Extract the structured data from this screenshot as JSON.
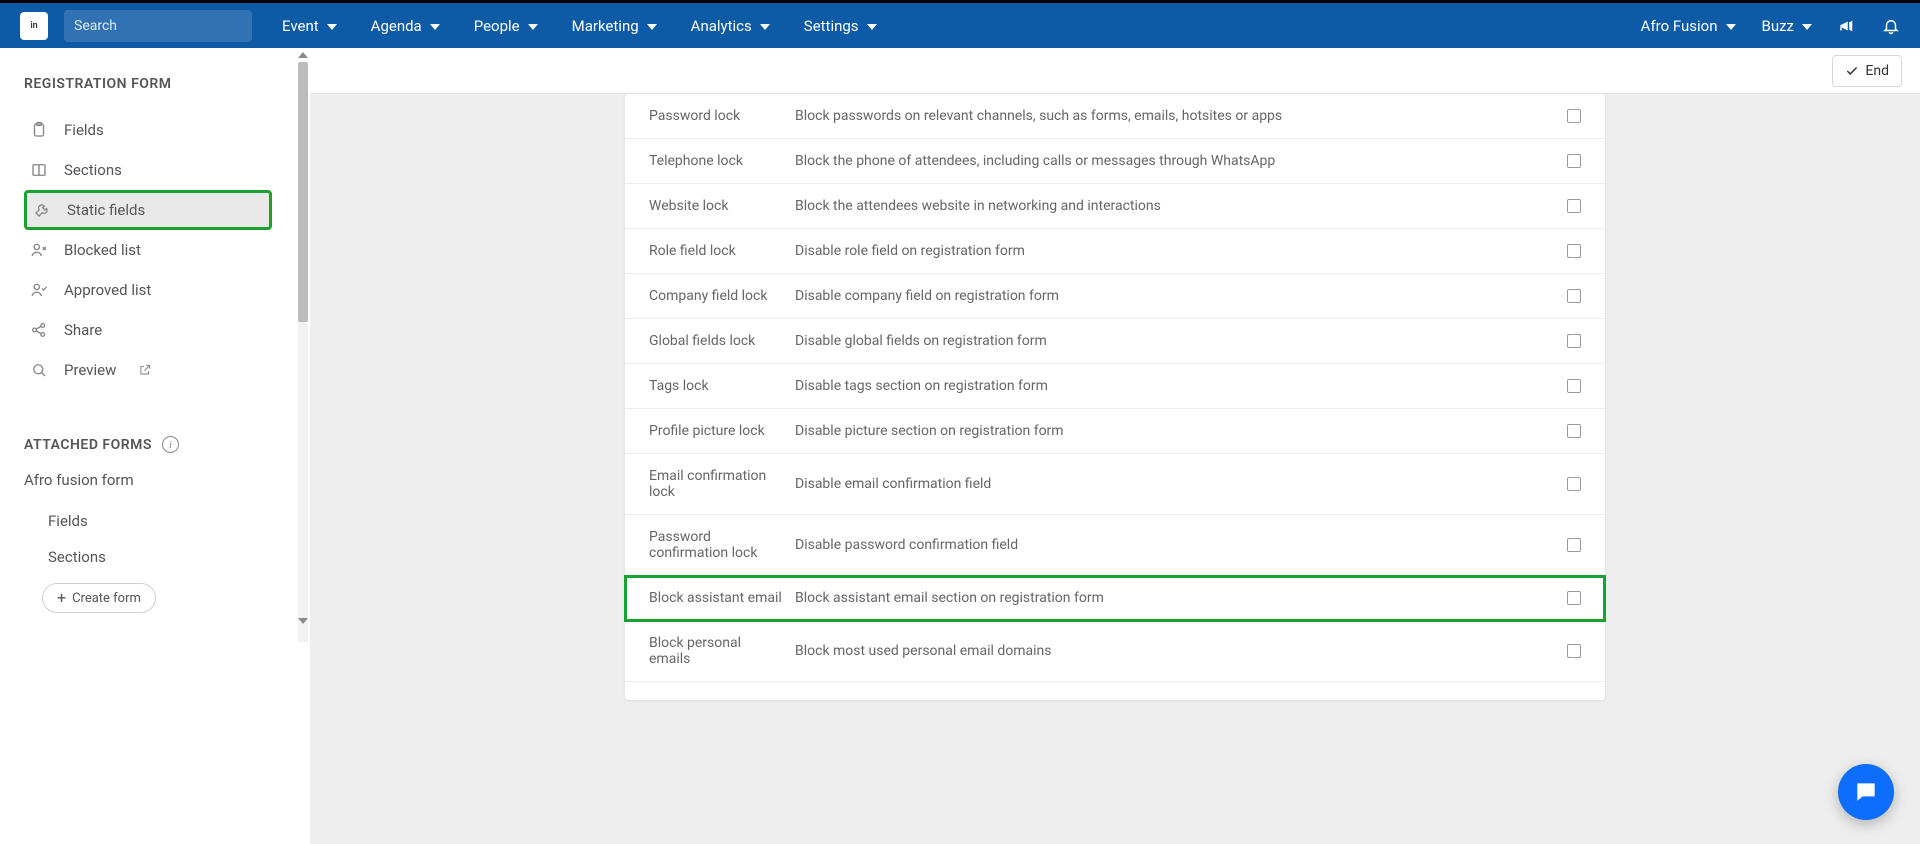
{
  "nav": {
    "search_placeholder": "Search",
    "items": [
      "Event",
      "Agenda",
      "People",
      "Marketing",
      "Analytics",
      "Settings"
    ],
    "right": {
      "org": "Afro Fusion",
      "user": "Buzz"
    }
  },
  "sidebar": {
    "heading": "REGISTRATION FORM",
    "items": [
      {
        "label": "Fields",
        "icon": "clipboard"
      },
      {
        "label": "Sections",
        "icon": "columns"
      },
      {
        "label": "Static fields",
        "icon": "wrench",
        "active": true
      },
      {
        "label": "Blocked list",
        "icon": "user-x"
      },
      {
        "label": "Approved list",
        "icon": "user-check"
      },
      {
        "label": "Share",
        "icon": "share"
      },
      {
        "label": "Preview",
        "icon": "search",
        "external": true
      }
    ],
    "attached_heading": "ATTACHED FORMS",
    "attached_form_name": "Afro fusion form",
    "attached_sub": [
      "Fields",
      "Sections"
    ],
    "create_label": "Create form"
  },
  "subheader": {
    "end_label": "End"
  },
  "table": {
    "rows": [
      {
        "name": "Password lock",
        "desc": "Block passwords on relevant channels, such as forms, emails, hotsites or apps"
      },
      {
        "name": "Telephone lock",
        "desc": "Block the phone of attendees, including calls or messages through WhatsApp"
      },
      {
        "name": "Website lock",
        "desc": "Block the attendees website in networking and interactions"
      },
      {
        "name": "Role field lock",
        "desc": "Disable role field on registration form"
      },
      {
        "name": "Company field lock",
        "desc": "Disable company field on registration form"
      },
      {
        "name": "Global fields lock",
        "desc": "Disable global fields on registration form"
      },
      {
        "name": "Tags lock",
        "desc": "Disable tags section on registration form"
      },
      {
        "name": "Profile picture lock",
        "desc": "Disable picture section on registration form"
      },
      {
        "name": "Email confirmation lock",
        "desc": "Disable email confirmation field"
      },
      {
        "name": "Password confirmation lock",
        "desc": "Disable password confirmation field"
      },
      {
        "name": "Block assistant email",
        "desc": "Block assistant email section on registration form",
        "highlight": true
      },
      {
        "name": "Block personal emails",
        "desc": "Block most used personal email domains"
      }
    ]
  }
}
